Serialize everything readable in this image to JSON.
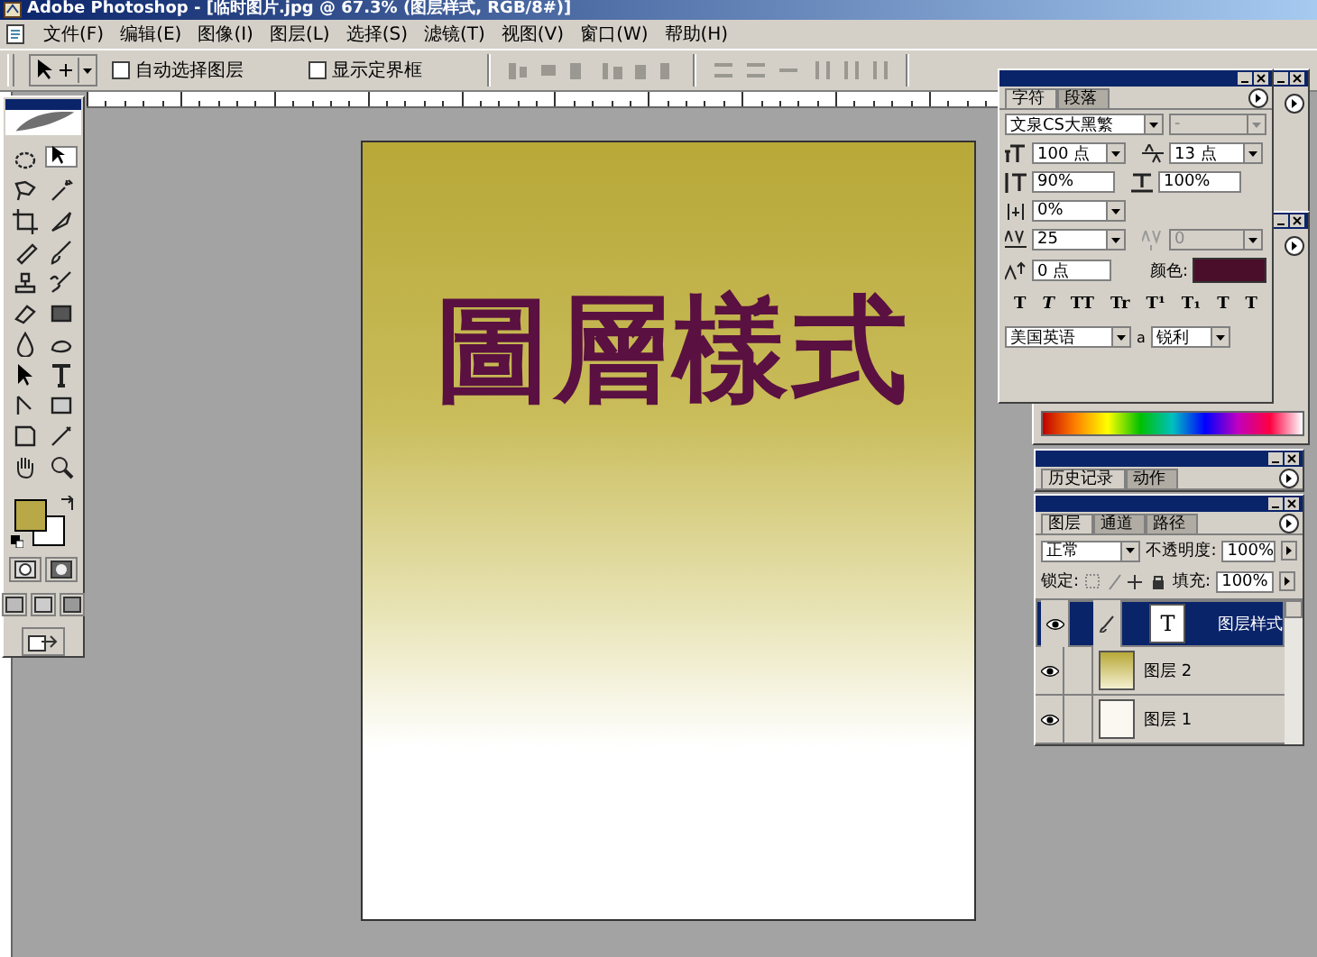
{
  "window": {
    "title": "Adobe Photoshop - [临时图片.jpg @ 67.3% (图层样式, RGB/8#)]"
  },
  "menu": [
    "文件(F)",
    "编辑(E)",
    "图像(I)",
    "图层(L)",
    "选择(S)",
    "滤镜(T)",
    "视图(V)",
    "窗口(W)",
    "帮助(H)"
  ],
  "options_bar": {
    "checkboxes": [
      {
        "label": "自动选择图层",
        "checked": false
      },
      {
        "label": "显示定界框",
        "checked": false
      }
    ]
  },
  "toolbox": {
    "tools": [
      {
        "selected": false
      },
      {
        "selected": true
      },
      {
        "selected": false
      },
      {
        "selected": false
      },
      {
        "selected": false
      },
      {
        "selected": false
      },
      {
        "selected": false
      },
      {
        "selected": false
      },
      {
        "selected": false
      },
      {
        "selected": false
      },
      {
        "selected": false
      },
      {
        "selected": false
      },
      {
        "selected": false
      },
      {
        "selected": false
      },
      {
        "selected": false
      },
      {
        "selected": false
      },
      {
        "selected": false
      },
      {
        "selected": false
      },
      {
        "selected": false
      },
      {
        "selected": false
      }
    ]
  },
  "document": {
    "text": "圖層樣式"
  },
  "character_panel": {
    "tabs": [
      {
        "label": "字符",
        "selected": true
      },
      {
        "label": "段落",
        "selected": false
      }
    ],
    "font_family": "文泉CS大黑繁",
    "font_style": "-",
    "font_size": "100 点",
    "leading": "13 点",
    "vertical_scale": "90%",
    "horizontal_scale": "100%",
    "tsume": "0%",
    "tracking": "25",
    "kerning": "0",
    "baseline_shift": "0 点",
    "color_label": "颜色:",
    "style_buttons": [
      "T",
      "T",
      "TT",
      "Tr",
      "T¹",
      "T₁",
      "T",
      "T"
    ],
    "language": "美国英语",
    "aa_label": "a",
    "antialias": "锐利"
  },
  "history_panel": {
    "tabs": [
      {
        "label": "历史记录",
        "selected": true
      },
      {
        "label": "动作",
        "selected": false
      }
    ]
  },
  "layers_panel": {
    "tabs": [
      {
        "label": "图层",
        "selected": true
      },
      {
        "label": "通道",
        "selected": false
      },
      {
        "label": "路径",
        "selected": false
      }
    ],
    "blend_mode": "正常",
    "opacity_label": "不透明度:",
    "opacity": "100%",
    "lock_label": "锁定:",
    "fill_label": "填充:",
    "fill": "100%",
    "layers": [
      {
        "name": "图层样式",
        "kind": "text",
        "thumbnail_text": "T",
        "selected": true,
        "visible": true,
        "linked": true
      },
      {
        "name": "图层 2",
        "kind": "gradient",
        "selected": false,
        "visible": true,
        "linked": false
      },
      {
        "name": "图层 1",
        "kind": "plain",
        "selected": false,
        "visible": true,
        "linked": false
      }
    ]
  }
}
